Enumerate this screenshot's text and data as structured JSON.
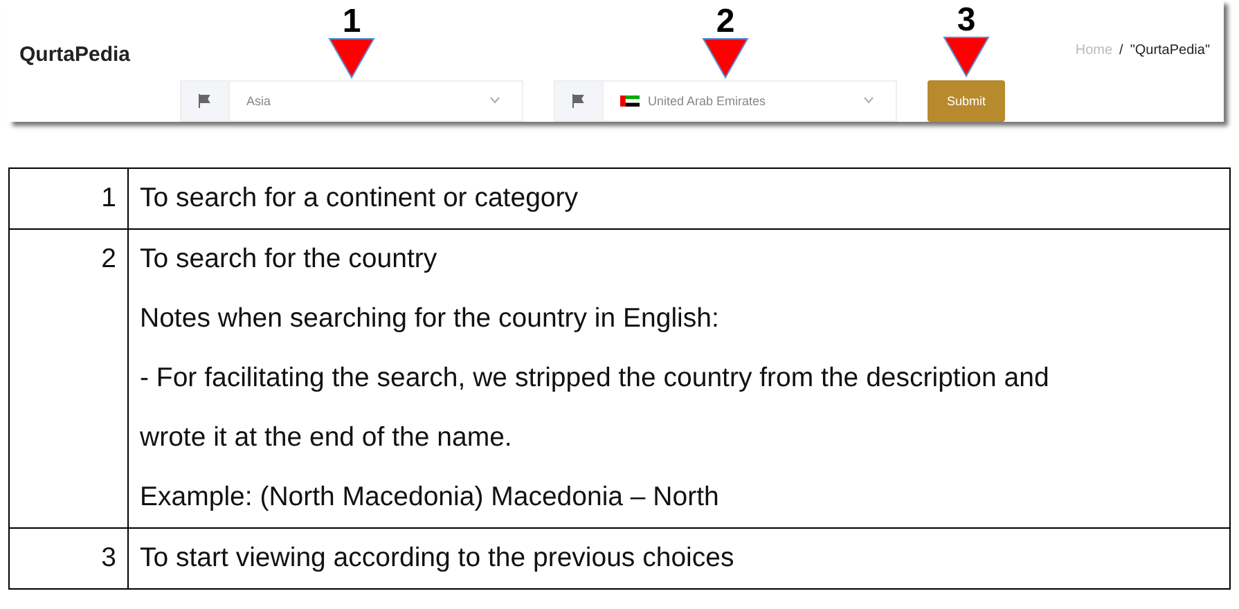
{
  "app": {
    "logo": "QurtaPedia",
    "fields": [
      {
        "value": "Asia",
        "country_flag": false,
        "marker": "1"
      },
      {
        "value": "United Arab Emirates",
        "country_flag": true,
        "marker": "2"
      }
    ],
    "submit": {
      "label": "Submit",
      "marker": "3"
    },
    "breadcrumb": [
      {
        "label": "Home",
        "current": false
      },
      {
        "label": "\"QurtaPedia\"",
        "current": true
      }
    ],
    "separator": "/"
  },
  "table": {
    "rows": [
      {
        "number": "1",
        "lines": [
          "To search for a continent or category"
        ]
      },
      {
        "number": "2",
        "lines": [
          "To search for the country",
          "Notes when searching for the country in English:",
          "- For facilitating the search, we stripped the country from the description and",
          "wrote it at the end of the name.",
          "Example: (North Macedonia)  Macedonia – North"
        ]
      },
      {
        "number": "3",
        "lines": [
          "To start viewing according to the previous choices"
        ]
      }
    ]
  }
}
